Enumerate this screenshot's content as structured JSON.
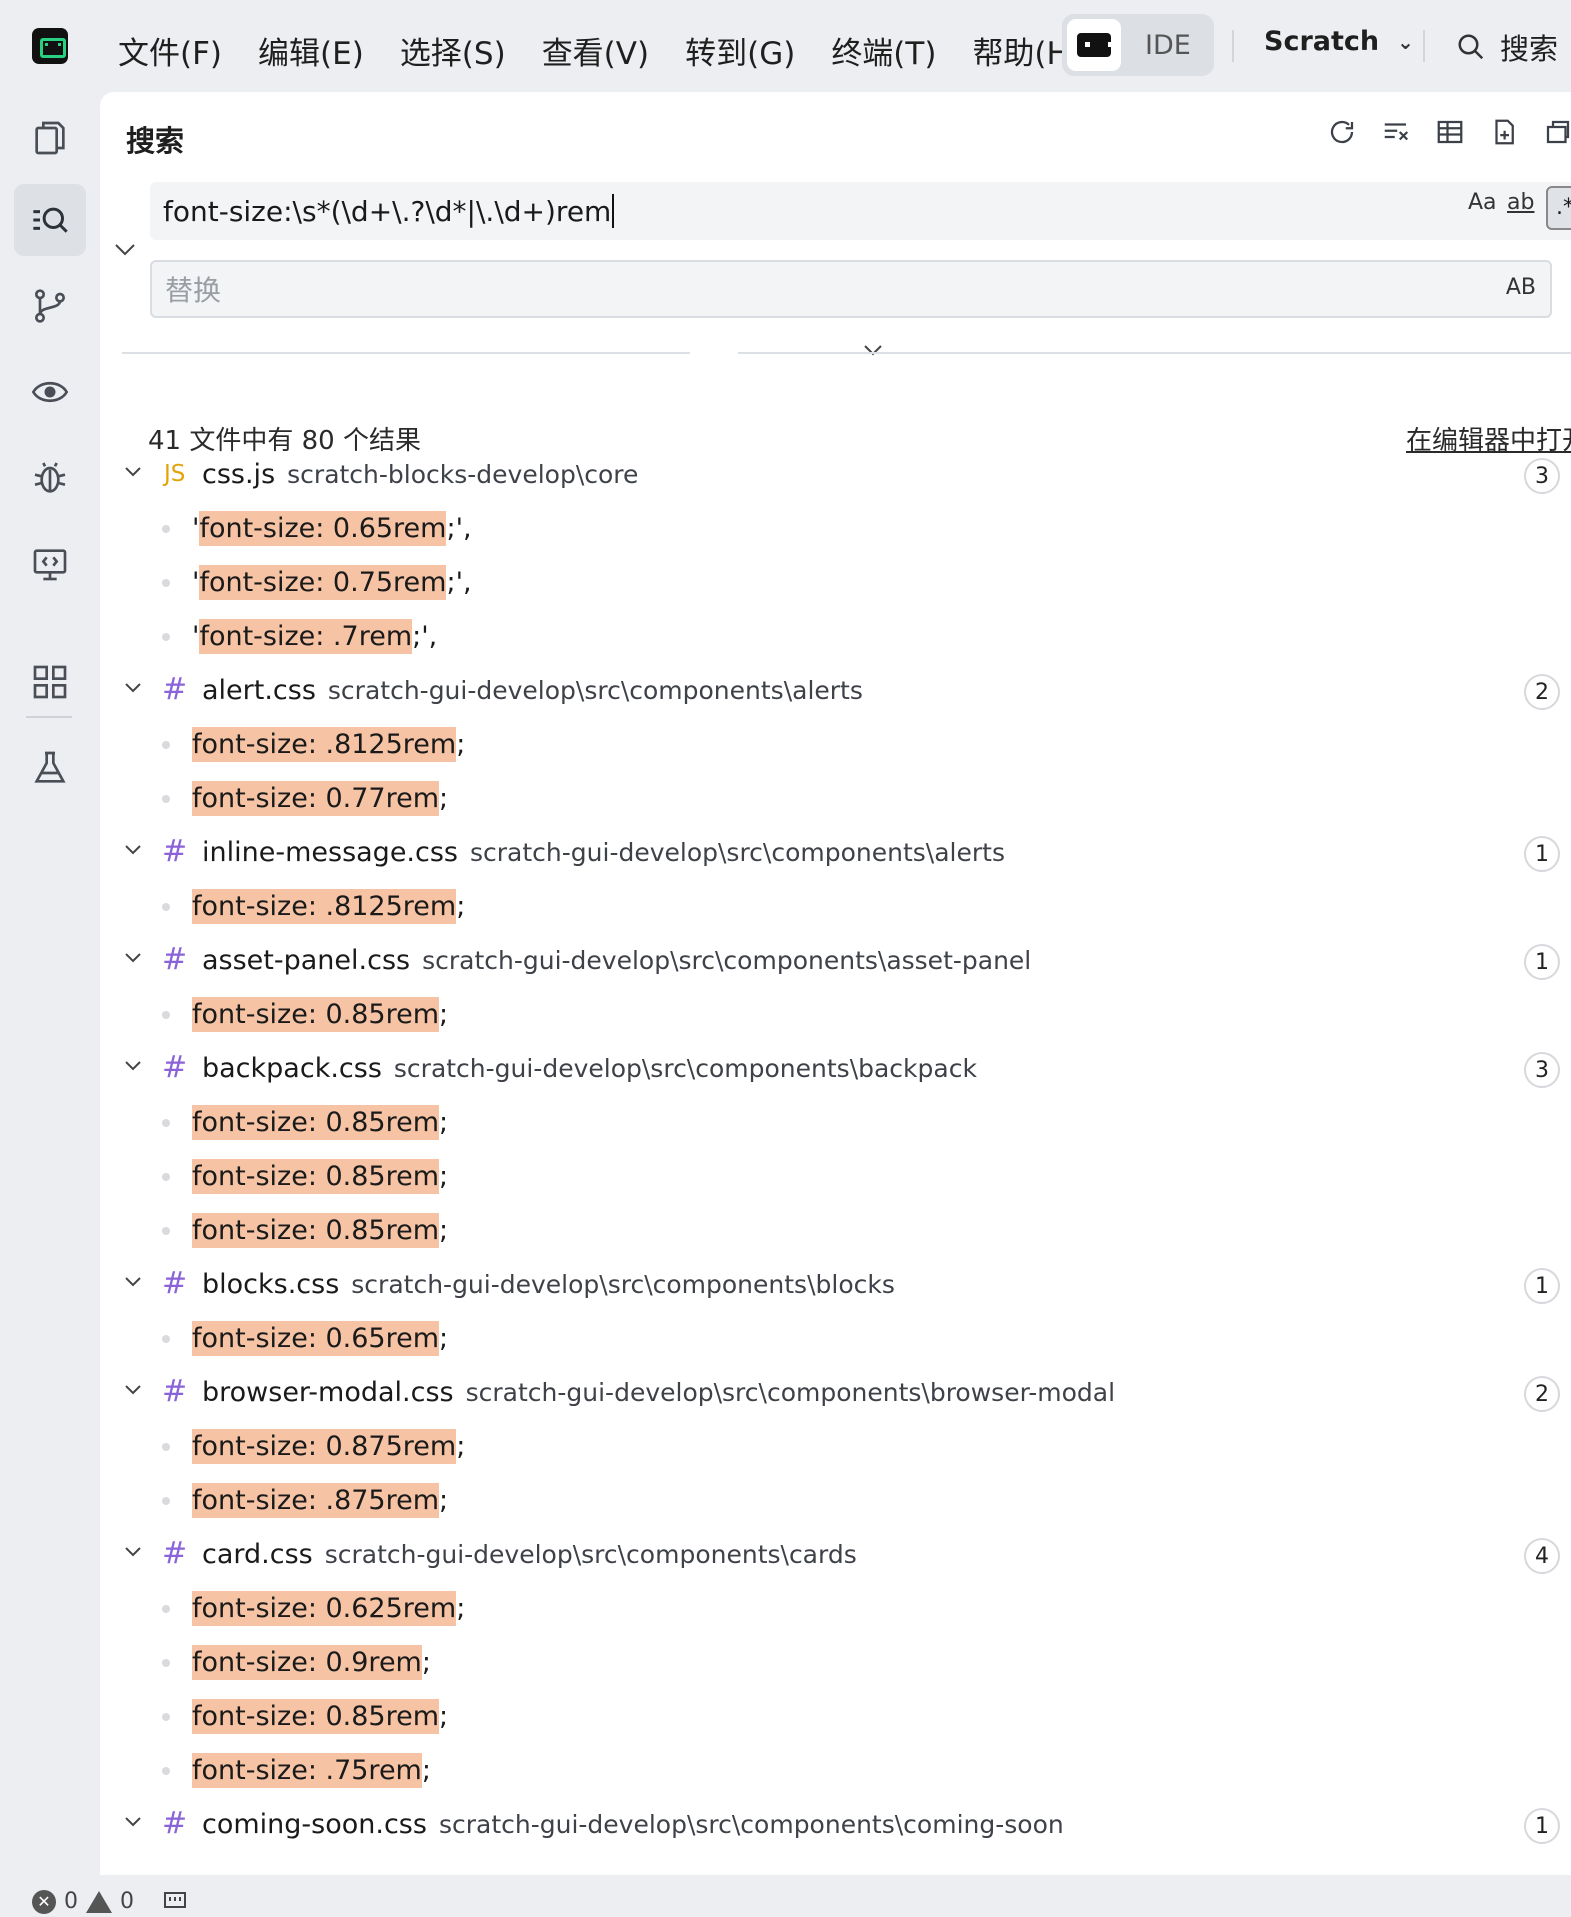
{
  "menu": {
    "items": [
      "文件(F)",
      "编辑(E)",
      "选择(S)",
      "查看(V)",
      "转到(G)",
      "终端(T)",
      "帮助(H)"
    ]
  },
  "mode_switch": {
    "label": "IDE"
  },
  "project": {
    "name": "Scratch"
  },
  "global_search": {
    "label": "搜索"
  },
  "panel": {
    "title": "搜索",
    "search_query": "font-size:\\s*(\\d+\\.?\\d*|\\.\\d+)rem",
    "match_case_label": "Aa",
    "whole_word_label": "ab",
    "regex_label": ".*",
    "replace_placeholder": "替换",
    "preserve_case_label": "AB",
    "summary": "41 文件中有 80 个结果",
    "open_in_editor": "在编辑器中打开"
  },
  "results": [
    {
      "icon": "JS",
      "type": "js",
      "name": "css.js",
      "path": "scratch-blocks-develop\\core",
      "count": "3",
      "matches": [
        {
          "pre": "'",
          "hit": "font-size: 0.65rem",
          "post": ";',"
        },
        {
          "pre": "'",
          "hit": "font-size: 0.75rem",
          "post": ";',"
        },
        {
          "pre": "'",
          "hit": "font-size: .7rem",
          "post": ";',"
        }
      ]
    },
    {
      "icon": "#",
      "type": "css",
      "name": "alert.css",
      "path": "scratch-gui-develop\\src\\components\\alerts",
      "count": "2",
      "matches": [
        {
          "pre": "",
          "hit": "font-size: .8125rem",
          "post": ";"
        },
        {
          "pre": "",
          "hit": "font-size: 0.77rem",
          "post": ";"
        }
      ]
    },
    {
      "icon": "#",
      "type": "css",
      "name": "inline-message.css",
      "path": "scratch-gui-develop\\src\\components\\alerts",
      "count": "1",
      "matches": [
        {
          "pre": "",
          "hit": "font-size: .8125rem",
          "post": ";"
        }
      ]
    },
    {
      "icon": "#",
      "type": "css",
      "name": "asset-panel.css",
      "path": "scratch-gui-develop\\src\\components\\asset-panel",
      "count": "1",
      "matches": [
        {
          "pre": "",
          "hit": "font-size: 0.85rem",
          "post": ";"
        }
      ]
    },
    {
      "icon": "#",
      "type": "css",
      "name": "backpack.css",
      "path": "scratch-gui-develop\\src\\components\\backpack",
      "count": "3",
      "matches": [
        {
          "pre": "",
          "hit": "font-size: 0.85rem",
          "post": ";"
        },
        {
          "pre": "",
          "hit": "font-size: 0.85rem",
          "post": ";"
        },
        {
          "pre": "",
          "hit": "font-size: 0.85rem",
          "post": ";"
        }
      ]
    },
    {
      "icon": "#",
      "type": "css",
      "name": "blocks.css",
      "path": "scratch-gui-develop\\src\\components\\blocks",
      "count": "1",
      "matches": [
        {
          "pre": "",
          "hit": "font-size: 0.65rem",
          "post": ";"
        }
      ]
    },
    {
      "icon": "#",
      "type": "css",
      "name": "browser-modal.css",
      "path": "scratch-gui-develop\\src\\components\\browser-modal",
      "count": "2",
      "matches": [
        {
          "pre": "",
          "hit": "font-size: 0.875rem",
          "post": ";"
        },
        {
          "pre": "",
          "hit": "font-size: .875rem",
          "post": ";"
        }
      ]
    },
    {
      "icon": "#",
      "type": "css",
      "name": "card.css",
      "path": "scratch-gui-develop\\src\\components\\cards",
      "count": "4",
      "matches": [
        {
          "pre": "",
          "hit": "font-size: 0.625rem",
          "post": ";"
        },
        {
          "pre": "",
          "hit": "font-size: 0.9rem",
          "post": ";"
        },
        {
          "pre": "",
          "hit": "font-size: 0.85rem",
          "post": ";"
        },
        {
          "pre": "",
          "hit": "font-size: .75rem",
          "post": ";"
        }
      ]
    },
    {
      "icon": "#",
      "type": "css",
      "name": "coming-soon.css",
      "path": "scratch-gui-develop\\src\\components\\coming-soon",
      "count": "1",
      "matches": []
    }
  ],
  "status": {
    "errors": "0",
    "warnings": "0"
  }
}
